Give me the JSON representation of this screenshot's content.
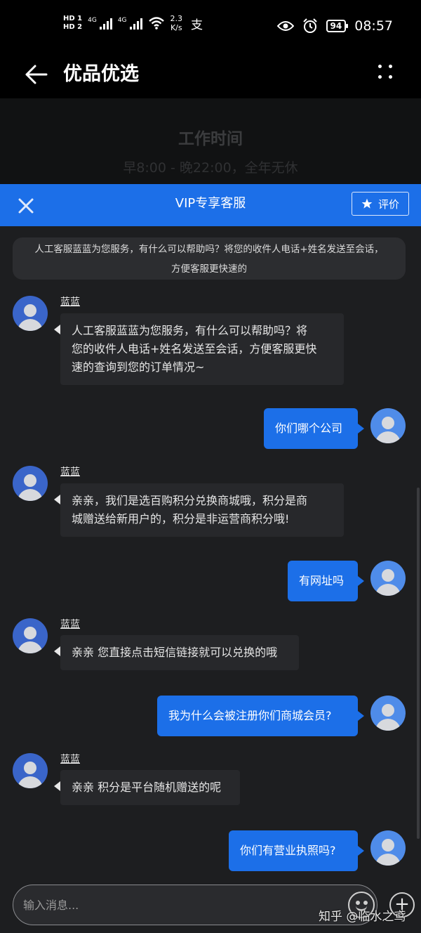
{
  "status_bar": {
    "sim1": "HD 1",
    "sim2": "HD 2",
    "network1": "4G",
    "network2": "4G",
    "speed_value": "2.3",
    "speed_unit": "K/s",
    "battery": "94",
    "time": "08:57",
    "icons": [
      "wifi-icon",
      "alipay-icon",
      "eye-icon",
      "alarm-icon"
    ]
  },
  "header": {
    "title": "优品优选",
    "back_icon": "arrow-left-icon",
    "more_icon": "dots-grid-icon"
  },
  "background": {
    "work_title": "工作时间",
    "work_hours": "早8:00 - 晚22:00，全年无休"
  },
  "vip": {
    "title": "VIP专享客服",
    "rate_label": "评价",
    "accent": "#1c6fe8"
  },
  "chat": {
    "system_notice_line1": "人工客服蓝蓝为您服务，有什么可以帮助吗？将您的收件人电话+姓名发送至会话，",
    "system_notice_line2": "方便客服更快速的",
    "messages": [
      {
        "from": "agent",
        "sender": "蓝蓝",
        "lines": [
          "人工客服蓝蓝为您服务，有什么可以帮助吗？将",
          "您的收件人电话+姓名发送至会话，方便客服更快",
          "速的查询到您的订单情况~"
        ]
      },
      {
        "from": "me",
        "text": "你们哪个公司"
      },
      {
        "from": "agent",
        "sender": "蓝蓝",
        "lines": [
          "亲亲，我们是选百购积分兑换商城哦，积分是商",
          "城赠送给新用户的，积分是非运营商积分哦!"
        ]
      },
      {
        "from": "me",
        "text": "有网址吗"
      },
      {
        "from": "agent",
        "sender": "蓝蓝",
        "lines": [
          "亲亲 您直接点击短信链接就可以兑换的哦"
        ]
      },
      {
        "from": "me",
        "text": "我为什么会被注册你们商城会员?"
      },
      {
        "from": "agent",
        "sender": "蓝蓝",
        "lines": [
          "亲亲 积分是平台随机赠送的呢"
        ]
      },
      {
        "from": "me",
        "text": "你们有营业执照吗?"
      }
    ]
  },
  "input": {
    "placeholder": "输入消息...",
    "watermark": "知乎 @临水之鸢"
  }
}
